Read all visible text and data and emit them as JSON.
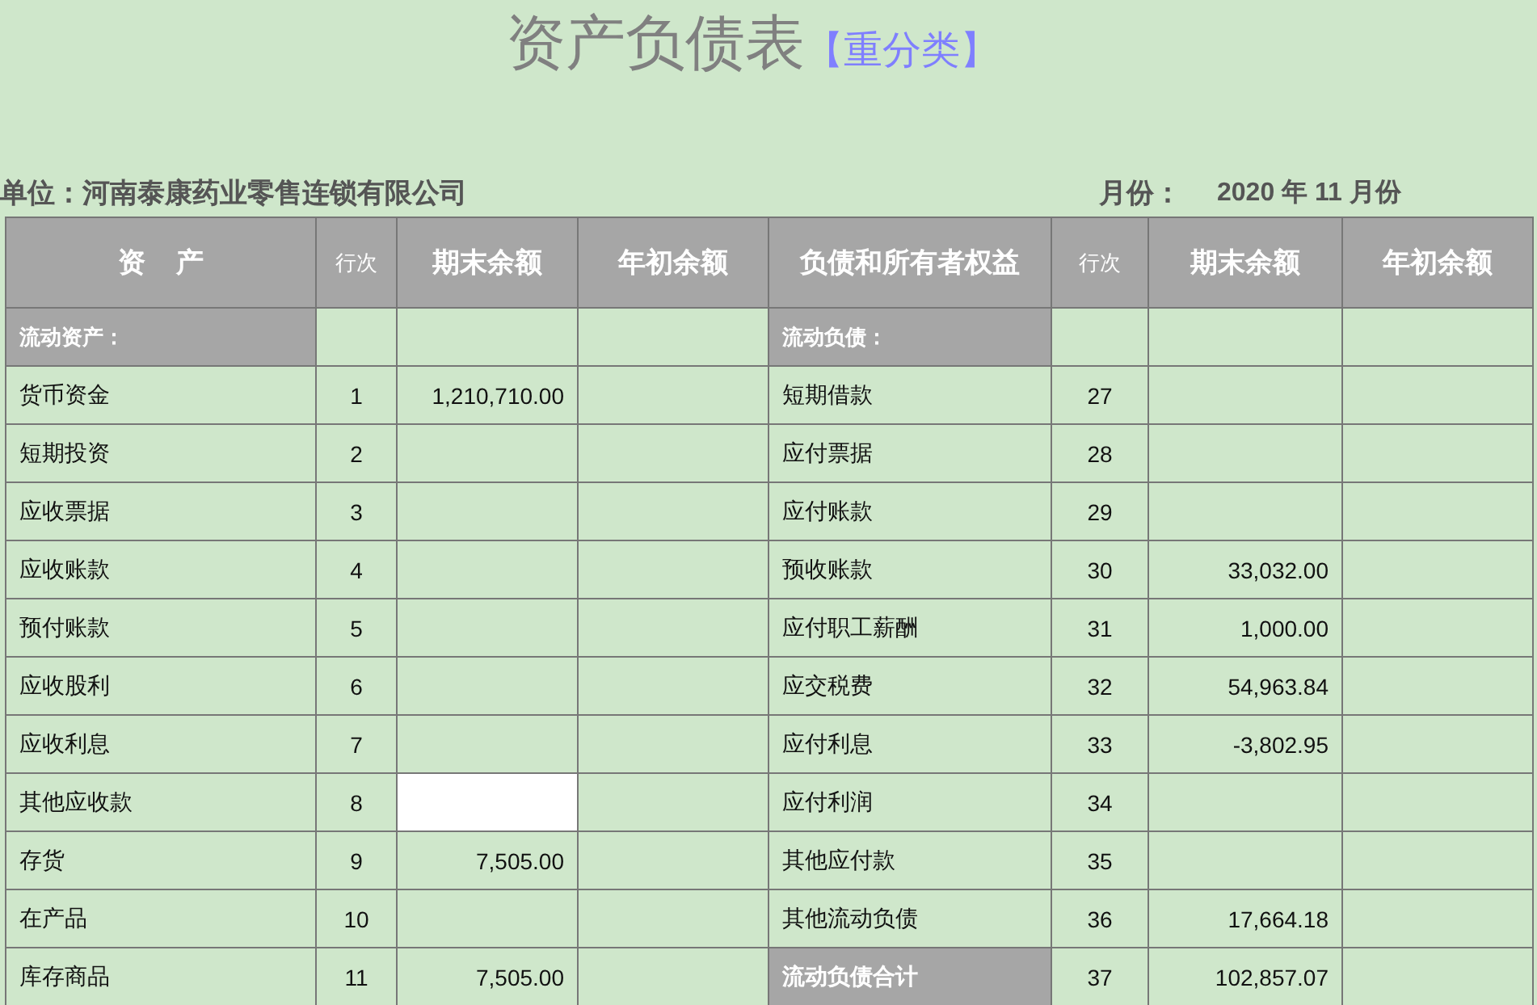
{
  "title": "资产负债表",
  "subtitle": "【重分类】",
  "unit": {
    "label": "单位：",
    "value": "河南泰康药业零售连锁有限公司"
  },
  "period": {
    "label": "月份：",
    "value": "2020 年 11 月份"
  },
  "columns": [
    "资    产",
    "行次",
    "期末余额",
    "年初余额",
    "负债和所有者权益",
    "行次",
    "期末余额",
    "年初余额"
  ],
  "rows": [
    {
      "left": {
        "kind": "section",
        "label": "流动资产：",
        "selected": false
      },
      "right": {
        "kind": "section",
        "label": "流动负债："
      }
    },
    {
      "left": {
        "kind": "item",
        "label": "货币资金",
        "line": "1",
        "end": "1,210,710.00",
        "selected": false
      },
      "right": {
        "kind": "item",
        "label": "短期借款",
        "line": "27"
      }
    },
    {
      "left": {
        "kind": "item",
        "label": "短期投资",
        "line": "2",
        "selected": false
      },
      "right": {
        "kind": "item",
        "label": "应付票据",
        "line": "28"
      }
    },
    {
      "left": {
        "kind": "item",
        "label": "应收票据",
        "line": "3",
        "selected": false
      },
      "right": {
        "kind": "item",
        "label": "应付账款",
        "line": "29"
      }
    },
    {
      "left": {
        "kind": "item",
        "label": "应收账款",
        "line": "4",
        "selected": false
      },
      "right": {
        "kind": "item",
        "label": "预收账款",
        "line": "30",
        "end": "33,032.00"
      }
    },
    {
      "left": {
        "kind": "item",
        "label": "预付账款",
        "line": "5",
        "selected": false
      },
      "right": {
        "kind": "item",
        "label": "应付职工薪酬",
        "line": "31",
        "end": "1,000.00"
      }
    },
    {
      "left": {
        "kind": "item",
        "label": "应收股利",
        "line": "6",
        "selected": false
      },
      "right": {
        "kind": "item",
        "label": "应交税费",
        "line": "32",
        "end": "54,963.84"
      }
    },
    {
      "left": {
        "kind": "item",
        "label": "应收利息",
        "line": "7",
        "selected": false
      },
      "right": {
        "kind": "item",
        "label": "应付利息",
        "line": "33",
        "end": "-3,802.95"
      }
    },
    {
      "left": {
        "kind": "item",
        "label": "其他应收款",
        "line": "8",
        "selected": true
      },
      "right": {
        "kind": "item",
        "label": "应付利润",
        "line": "34"
      }
    },
    {
      "left": {
        "kind": "item",
        "label": "存货",
        "line": "9",
        "end": "7,505.00",
        "selected": false
      },
      "right": {
        "kind": "item",
        "label": "其他应付款",
        "line": "35"
      }
    },
    {
      "left": {
        "kind": "item",
        "label": "在产品",
        "line": "10",
        "selected": false
      },
      "right": {
        "kind": "item",
        "label": "其他流动负债",
        "line": "36",
        "end": "17,664.18"
      }
    },
    {
      "left": {
        "kind": "item",
        "label": "库存商品",
        "line": "11",
        "end": "7,505.00",
        "selected": false
      },
      "right": {
        "kind": "total",
        "label": "流动负债合计",
        "line": "37",
        "end": "102,857.07"
      }
    }
  ]
}
